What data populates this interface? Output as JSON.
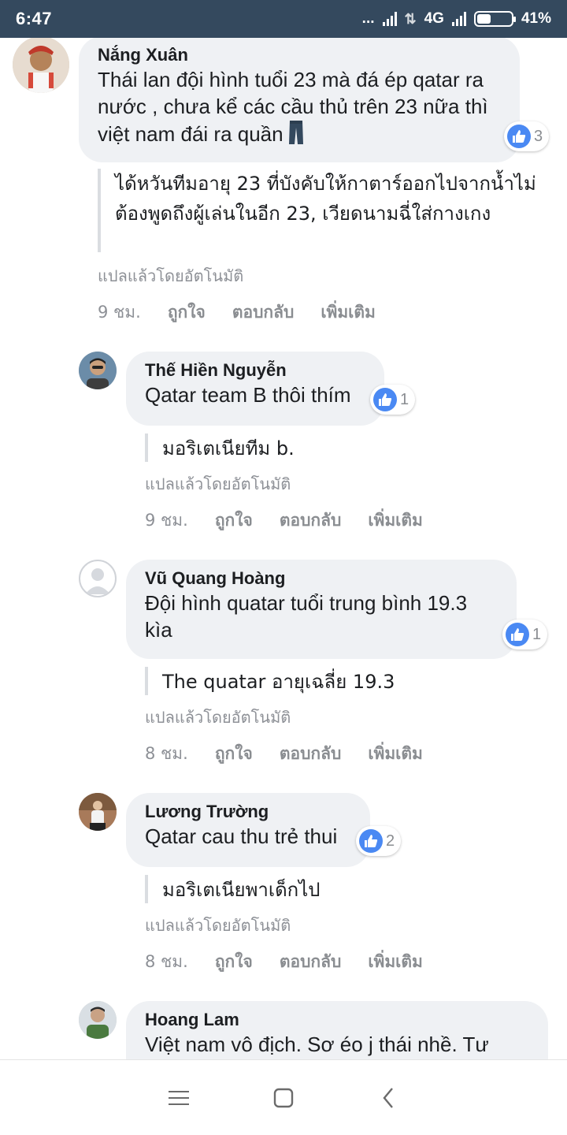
{
  "status": {
    "time": "6:47",
    "dots": "...",
    "network": "4G",
    "battery": "41%",
    "battery_level": 0.41
  },
  "comments": [
    {
      "author": "Nắng Xuân",
      "text": "Thái lan đội hình tuổi 23 mà đá ép qatar ra nước , chưa kể các cầu thủ trên 23 nữa thì việt nam đái ra quần",
      "likes": "3",
      "translation": "ได้หวันทีมอายุ 23 ที่บังคับให้กาตาร์ออกไปจากน้ำไม่ต้องพูดถึงผู้เล่นในอีก 23, เวียดนามฉี่ใส่กางเกง",
      "translated_note": "แปลแล้วโดยอัตโนมัติ",
      "time": "9 ชม.",
      "like_label": "ถูกใจ",
      "reply_label": "ตอบกลับ",
      "more_label": "เพิ่มเติม"
    },
    {
      "author": "Thế Hiền Nguyễn",
      "text": "Qatar team B thôi thím",
      "likes": "1",
      "translation": "มอริเตเนียทีม b.",
      "translated_note": "แปลแล้วโดยอัตโนมัติ",
      "time": "9 ชม.",
      "like_label": "ถูกใจ",
      "reply_label": "ตอบกลับ",
      "more_label": "เพิ่มเติม"
    },
    {
      "author": "Vũ Quang Hoàng",
      "text": "Đội hình quatar tuổi trung bình 19.3 kìa",
      "likes": "1",
      "translation": "The quatar อายุเฉลี่ย 19.3",
      "translated_note": "แปลแล้วโดยอัตโนมัติ",
      "time": "8 ชม.",
      "like_label": "ถูกใจ",
      "reply_label": "ตอบกลับ",
      "more_label": "เพิ่มเติม"
    },
    {
      "author": "Lương Trường",
      "text": "Qatar cau thu trẻ thui",
      "likes": "2",
      "translation": "มอริเตเนียพาเด็กไป",
      "translated_note": "แปลแล้วโดยอัตโนมัติ",
      "time": "8 ชม.",
      "like_label": "ถูกใจ",
      "reply_label": "ตอบกลับ",
      "more_label": "เพิ่มเติม"
    },
    {
      "author": "Hoang Lam",
      "text": "Việt nam vô địch. Sơ éo j thái nhề. Tư"
    }
  ],
  "nav": {
    "menu_icon": "menu-icon",
    "home_icon": "home-square-icon",
    "back_icon": "back-chevron-icon"
  },
  "colors": {
    "status_bar": "#34495e",
    "bubble": "#eff1f4",
    "like_blue": "#4a89f3",
    "meta_gray": "#8d9096"
  }
}
